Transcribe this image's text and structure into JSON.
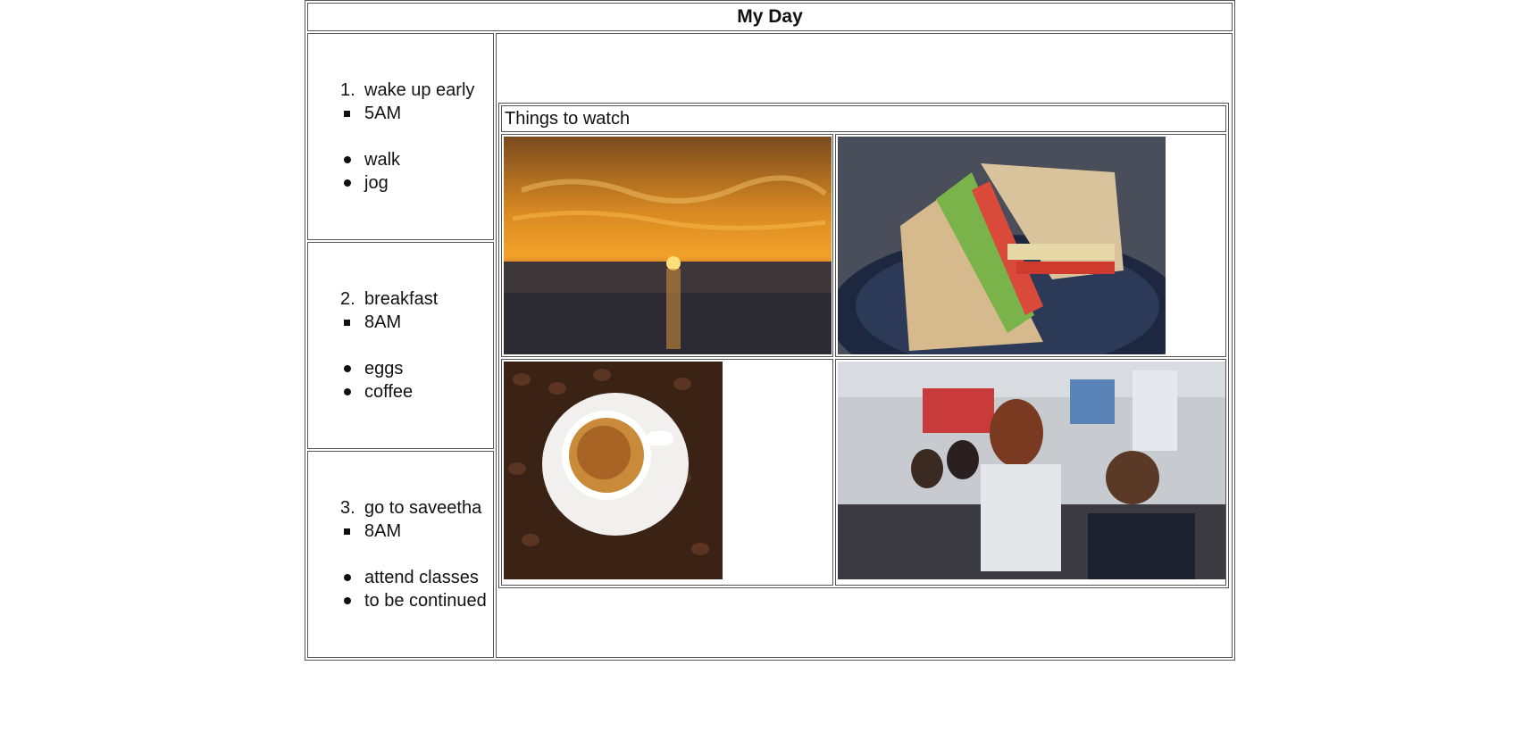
{
  "page": {
    "title": "My Day"
  },
  "schedule": [
    {
      "number": "1.",
      "task": "wake up early",
      "time": "5AM",
      "items": [
        "walk",
        "jog"
      ]
    },
    {
      "number": "2.",
      "task": "breakfast",
      "time": "8AM",
      "items": [
        "eggs",
        "coffee"
      ]
    },
    {
      "number": "3.",
      "task": "go to saveetha",
      "time": "8AM",
      "items": [
        "attend classes",
        "to be continued"
      ]
    }
  ],
  "watch": {
    "label": "Things to watch",
    "images": [
      "sunset-photo",
      "sandwich-photo",
      "coffee-photo",
      "classroom-photo"
    ]
  }
}
